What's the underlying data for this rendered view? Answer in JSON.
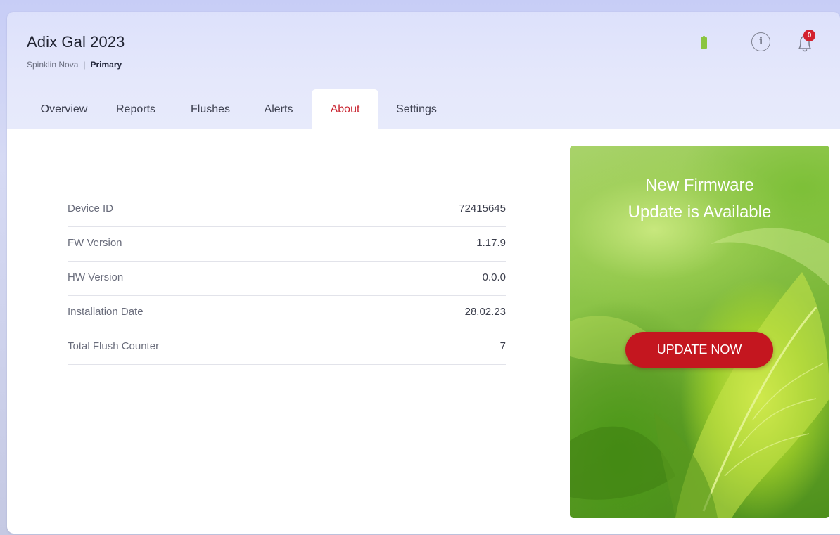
{
  "device": {
    "name": "Adix Gal 2023",
    "model": "Spinklin Nova",
    "separator": "|",
    "role": "Primary"
  },
  "status": {
    "battery_icon": "battery-full-icon",
    "battery_color": "#8bc53f",
    "info_icon": "info-icon",
    "info_glyph": "ℹ",
    "bell_icon": "bell-icon",
    "notification_count": "0"
  },
  "tabs": [
    {
      "label": "Overview"
    },
    {
      "label": "Reports"
    },
    {
      "label": "Flushes"
    },
    {
      "label": "Alerts"
    },
    {
      "label": "About",
      "active": true
    },
    {
      "label": "Settings"
    }
  ],
  "about": {
    "rows": [
      {
        "label": "Device ID",
        "value": "72415645"
      },
      {
        "label": "FW Version",
        "value": "1.17.9"
      },
      {
        "label": "HW Version",
        "value": "0.0.0"
      },
      {
        "label": "Installation Date",
        "value": "28.02.23"
      },
      {
        "label": "Total Flush Counter",
        "value": "7"
      }
    ]
  },
  "promo": {
    "title_line1": "New Firmware",
    "title_line2": "Update is Available",
    "button_label": "UPDATE NOW"
  },
  "colors": {
    "accent": "#c8212d",
    "button": "#c4161f",
    "header_bg": "#dde1fb"
  }
}
